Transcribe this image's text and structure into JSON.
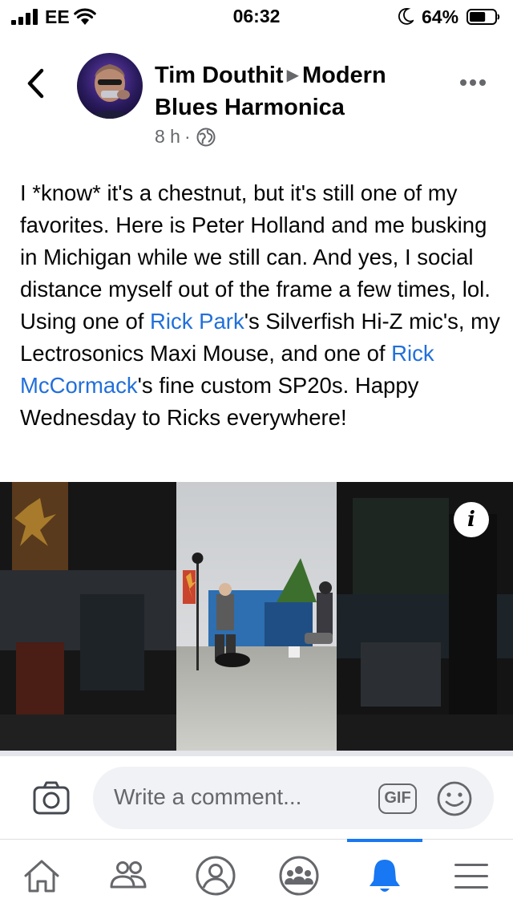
{
  "status_bar": {
    "carrier": "EE",
    "time": "06:32",
    "battery_percent": "64%",
    "battery_level": 0.64
  },
  "post": {
    "author": "Tim Douthit",
    "group": "Modern Blues Harmonica",
    "time_ago": "8 h",
    "separator": "·",
    "audience_icon": "globe-icon",
    "text": {
      "p1": "I *know* it's a chestnut, but it's still one of my favorites.  Here is Peter Holland and me busking in Michigan while we still can.  And yes, I social distance myself out of the frame a few times, lol.  Using one of ",
      "link1": "Rick Park",
      "p2": "'s Silverfish Hi-Z mic's, my Lectrosonics Maxi Mouse, and one of ",
      "link2": "Rick McCormack",
      "p3": "'s fine custom SP20s.  Happy Wednesday to Ricks everywhere!"
    },
    "info_label": "i"
  },
  "comment_bar": {
    "placeholder": "Write a comment...",
    "gif_label": "GIF"
  },
  "tabs": [
    {
      "icon": "home-icon",
      "active": false
    },
    {
      "icon": "friends-icon",
      "active": false
    },
    {
      "icon": "profile-icon",
      "active": false
    },
    {
      "icon": "groups-icon",
      "active": false
    },
    {
      "icon": "notifications-bell-icon",
      "active": true
    },
    {
      "icon": "menu-icon",
      "active": false
    }
  ],
  "colors": {
    "accent": "#1877f2",
    "link": "#216fdb",
    "secondary_text": "#65676b",
    "comment_bg": "#f0f2f5"
  }
}
